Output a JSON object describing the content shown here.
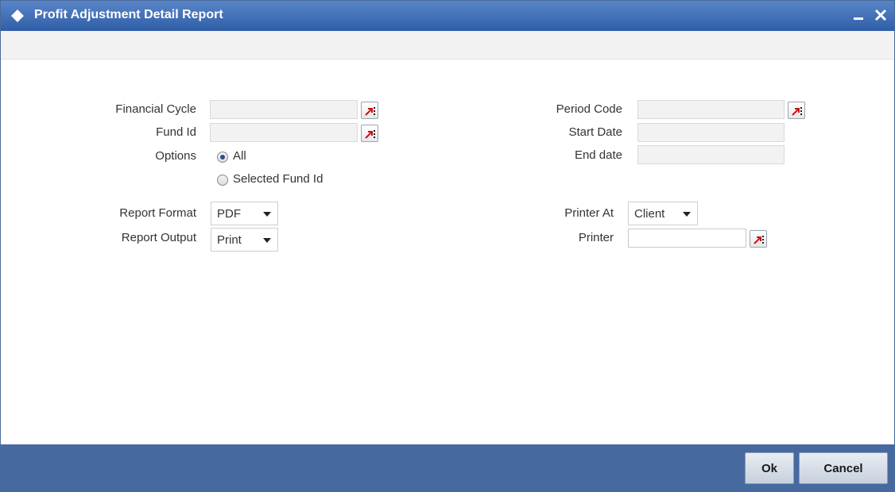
{
  "window": {
    "title": "Profit Adjustment Detail Report",
    "title_icon": "diamond-icon",
    "minimize_icon": "minimize-icon",
    "close_icon": "close-icon",
    "colors": {
      "titlebar": "#3b6cb5",
      "footer": "#466aa0",
      "lov_arrow": "#cc1111"
    }
  },
  "form": {
    "financial_cycle": {
      "label": "Financial Cycle",
      "value": ""
    },
    "fund_id": {
      "label": "Fund Id",
      "value": ""
    },
    "options": {
      "label": "Options",
      "choices": [
        {
          "label": "All",
          "selected": true
        },
        {
          "label": "Selected Fund Id",
          "selected": false
        }
      ]
    },
    "period_code": {
      "label": "Period Code",
      "value": ""
    },
    "start_date": {
      "label": "Start Date",
      "value": ""
    },
    "end_date": {
      "label": "End date",
      "value": ""
    },
    "report_format": {
      "label": "Report Format",
      "value": "PDF"
    },
    "report_output": {
      "label": "Report Output",
      "value": "Print"
    },
    "printer_at": {
      "label": "Printer At",
      "value": "Client"
    },
    "printer": {
      "label": "Printer",
      "value": ""
    }
  },
  "footer": {
    "ok_label": "Ok",
    "cancel_label": "Cancel"
  }
}
